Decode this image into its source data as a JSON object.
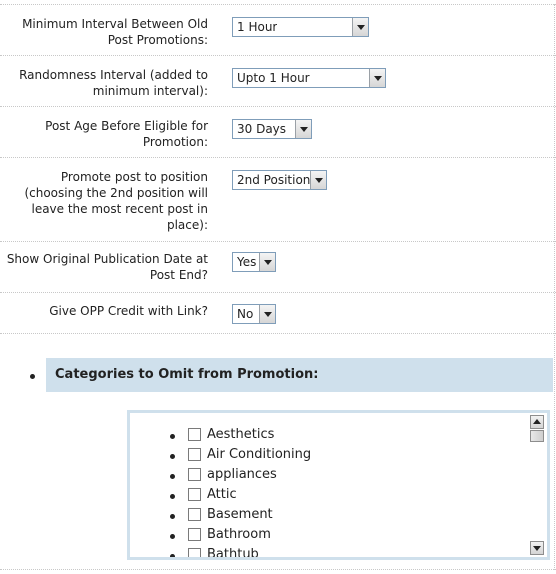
{
  "settings": [
    {
      "label": "Minimum Interval Between Old Post Promotions:",
      "value": "1 Hour"
    },
    {
      "label": "Randomness Interval (added to minimum interval):",
      "value": "Upto 1 Hour"
    },
    {
      "label": "Post Age Before Eligible for Promotion:",
      "value": "30 Days"
    },
    {
      "label": "Promote post to position (choosing the 2nd position will leave the most recent post in place):",
      "value": "2nd Position"
    },
    {
      "label": "Show Original Publication Date at Post End?",
      "value": "Yes"
    },
    {
      "label": "Give OPP Credit with Link?",
      "value": "No"
    }
  ],
  "categories": {
    "heading": "Categories to Omit from Promotion:",
    "items": [
      "Aesthetics",
      "Air Conditioning",
      "appliances",
      "Attic",
      "Basement",
      "Bathroom",
      "Bathtub"
    ]
  },
  "colors": {
    "header_bg": "#cfe0ec",
    "select_border": "#7f9db9"
  }
}
